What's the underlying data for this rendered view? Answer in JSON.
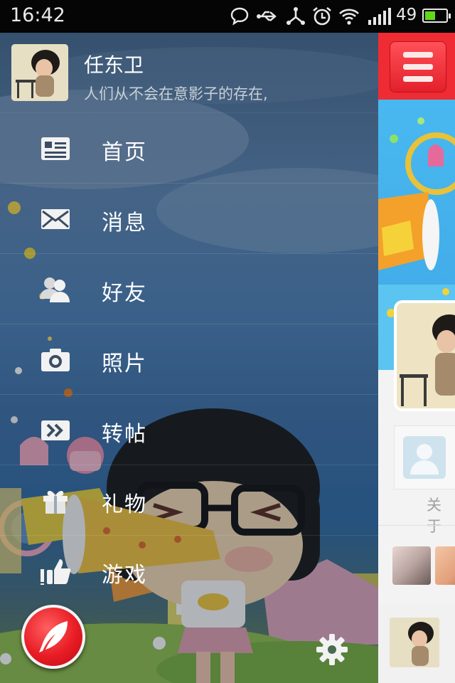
{
  "status_bar": {
    "time": "16:42",
    "battery_level": "49",
    "icons": [
      "chat-bubble-icon",
      "usb-icon",
      "share-icon",
      "alarm-icon",
      "wifi-icon",
      "signal-icon",
      "battery-icon"
    ]
  },
  "drawer": {
    "profile": {
      "name": "任东卫",
      "status": "人们从不会在意影子的存在,"
    },
    "menu": [
      {
        "label": "首页",
        "icon": "news-feed-icon"
      },
      {
        "label": "消息",
        "icon": "envelope-icon"
      },
      {
        "label": "好友",
        "icon": "friends-icon"
      },
      {
        "label": "照片",
        "icon": "camera-icon"
      },
      {
        "label": "转帖",
        "icon": "share-forward-icon"
      },
      {
        "label": "礼物",
        "icon": "gift-icon"
      },
      {
        "label": "游戏",
        "icon": "thumbs-up-icon"
      }
    ],
    "fab_icon": "feather-icon",
    "settings_icon": "gear-icon"
  },
  "content": {
    "menu_button_icon": "hamburger-icon",
    "about_label": "关于"
  },
  "colors": {
    "brand_red": "#ef2b34",
    "drawer_blue": "#4c7fb6",
    "battery_green": "#62d81a"
  }
}
